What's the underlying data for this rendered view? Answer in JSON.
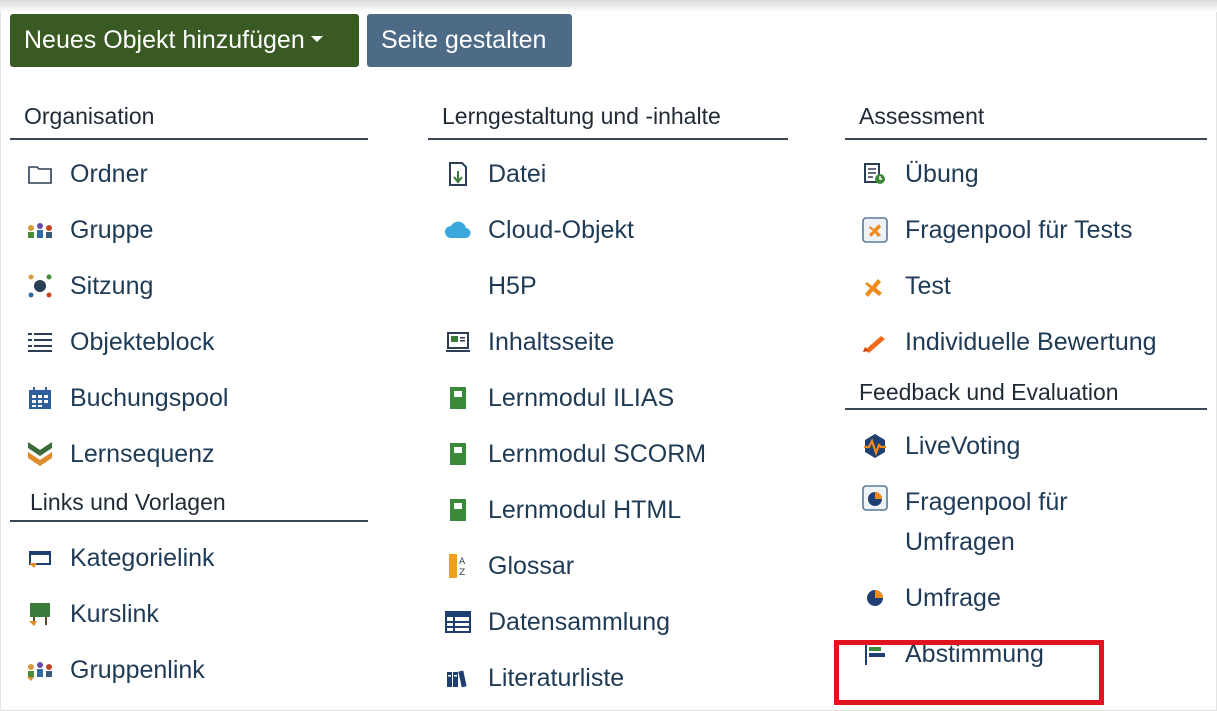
{
  "toolbar": {
    "add_object_label": "Neues Objekt hinzufügen",
    "design_page_label": "Seite gestalten"
  },
  "columns": {
    "organisation": {
      "header": "Organisation",
      "items": [
        {
          "label": "Ordner",
          "icon": "folder-icon"
        },
        {
          "label": "Gruppe",
          "icon": "group-icon"
        },
        {
          "label": "Sitzung",
          "icon": "session-icon"
        },
        {
          "label": "Objekteblock",
          "icon": "list-icon"
        },
        {
          "label": "Buchungspool",
          "icon": "calendar-icon"
        },
        {
          "label": "Lernsequenz",
          "icon": "learning-sequence-icon"
        }
      ]
    },
    "links": {
      "header": "Links und Vorlagen",
      "items": [
        {
          "label": "Kategorielink",
          "icon": "category-link-icon"
        },
        {
          "label": "Kurslink",
          "icon": "course-link-icon"
        },
        {
          "label": "Gruppenlink",
          "icon": "group-link-icon"
        }
      ]
    },
    "learning": {
      "header": "Lerngestaltung und -inhalte",
      "items": [
        {
          "label": "Datei",
          "icon": "file-icon"
        },
        {
          "label": "Cloud-Objekt",
          "icon": "cloud-icon"
        },
        {
          "label": "H5P",
          "icon": ""
        },
        {
          "label": "Inhaltsseite",
          "icon": "content-page-icon"
        },
        {
          "label": "Lernmodul ILIAS",
          "icon": "module-icon"
        },
        {
          "label": "Lernmodul SCORM",
          "icon": "module-icon"
        },
        {
          "label": "Lernmodul HTML",
          "icon": "module-icon"
        },
        {
          "label": "Glossar",
          "icon": "glossary-icon"
        },
        {
          "label": "Datensammlung",
          "icon": "table-icon"
        },
        {
          "label": "Literaturliste",
          "icon": "books-icon"
        }
      ]
    },
    "assessment": {
      "header": "Assessment",
      "items": [
        {
          "label": "Übung",
          "icon": "exercise-icon"
        },
        {
          "label": "Fragenpool für Tests",
          "icon": "question-pool-icon"
        },
        {
          "label": "Test",
          "icon": "test-icon"
        },
        {
          "label": "Individuelle Bewertung",
          "icon": "pen-icon"
        }
      ]
    },
    "feedback": {
      "header": "Feedback und Evaluation",
      "items": [
        {
          "label": "LiveVoting",
          "icon": "live-voting-icon"
        },
        {
          "label": "Fragenpool für Umfragen",
          "icon": "survey-pool-icon"
        },
        {
          "label": "Umfrage",
          "icon": "survey-icon"
        },
        {
          "label": "Abstimmung",
          "icon": "poll-icon"
        }
      ]
    }
  },
  "colors": {
    "primary_button": "#3a5a24",
    "secondary_button": "#4d6b86",
    "highlight": "#e0141e"
  }
}
